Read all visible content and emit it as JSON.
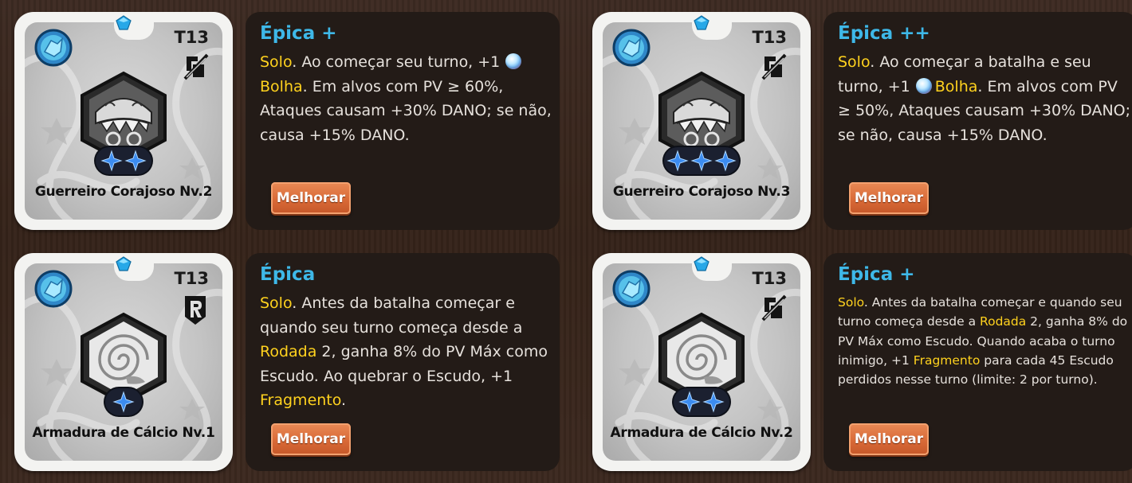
{
  "items": [
    {
      "name": "Guerreiro Corajoso Nv.2",
      "tier": "T13",
      "type_icon": "no-melee-icon",
      "emblem": "shark-mask-emblem",
      "stars": 2,
      "rarity": "Épica +",
      "button_label": "Melhorar",
      "small_text": false,
      "desc": [
        {
          "t": "Solo",
          "hl": true
        },
        {
          "t": ". Ao começar seu turno, +1 "
        },
        {
          "bubble": true
        },
        {
          "t": "Bolha",
          "hl": true
        },
        {
          "t": ". Em alvos com PV ≥ 60%, Ataques causam +30% DANO; se não, causa +15% DANO."
        }
      ]
    },
    {
      "name": "Guerreiro Corajoso Nv.3",
      "tier": "T13",
      "type_icon": "no-melee-icon",
      "emblem": "shark-mask-emblem",
      "stars": 3,
      "rarity": "Épica ++",
      "button_label": "Melhorar",
      "small_text": false,
      "desc": [
        {
          "t": "Solo",
          "hl": true
        },
        {
          "t": ". Ao começar a batalha e seu turno, +1 "
        },
        {
          "bubble": true
        },
        {
          "t": "Bolha",
          "hl": true
        },
        {
          "t": ". Em alvos com PV ≥ 50%, Ataques causam +30% DANO; se não, causa +15% DANO."
        }
      ]
    },
    {
      "name": "Armadura de Cálcio Nv.1",
      "tier": "T13",
      "type_icon": "ranged-r-icon",
      "emblem": "shell-emblem",
      "stars": 1,
      "rarity": "Épica",
      "button_label": "Melhorar",
      "small_text": false,
      "desc": [
        {
          "t": "Solo",
          "hl": true
        },
        {
          "t": ". Antes da batalha começar e quando seu turno começa desde a "
        },
        {
          "t": "Rodada",
          "hl": true
        },
        {
          "t": " 2, ganha 8% do PV Máx como Escudo. Ao quebrar o Escudo, +1 "
        },
        {
          "t": "Fragmento",
          "hl": true
        },
        {
          "t": "."
        }
      ]
    },
    {
      "name": "Armadura de Cálcio Nv.2",
      "tier": "T13",
      "type_icon": "no-melee-icon",
      "emblem": "shell-emblem",
      "stars": 2,
      "rarity": "Épica +",
      "button_label": "Melhorar",
      "small_text": true,
      "desc": [
        {
          "t": "Solo",
          "hl": true
        },
        {
          "t": ". Antes da batalha começar e quando seu turno começa desde a "
        },
        {
          "t": "Rodada",
          "hl": true
        },
        {
          "t": " 2, ganha 8% do PV Máx como Escudo. Quando acaba o turno inimigo, +1 "
        },
        {
          "t": "Fragmento",
          "hl": true
        },
        {
          "t": " para cada 45 Escudo perdidos nesse turno (limite: 2 por turno)."
        }
      ]
    }
  ],
  "colors": {
    "rarity": "#3eb8e8",
    "highlight": "#ffd21e",
    "panel": "#231b17",
    "button": "#d96a37",
    "background": "#3a2721"
  }
}
